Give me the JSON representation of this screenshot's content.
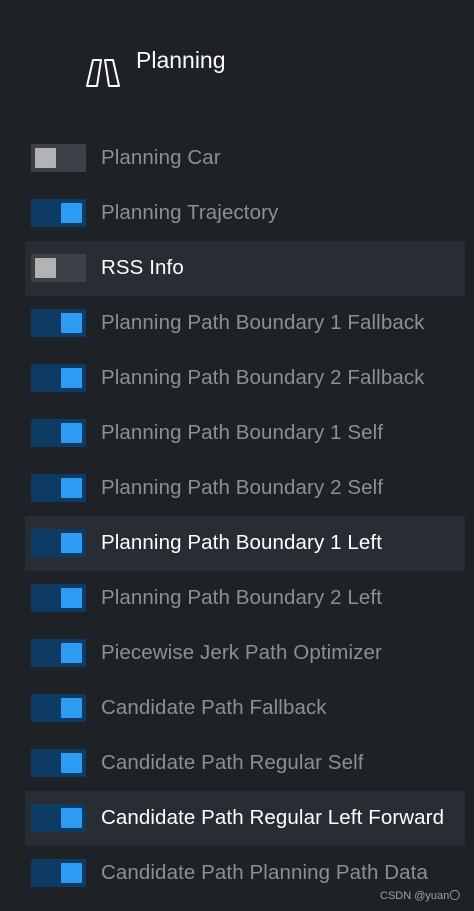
{
  "header": {
    "title": "Planning",
    "icon": "road-icon"
  },
  "items": [
    {
      "label": "Planning Car",
      "enabled": false,
      "highlighted": false
    },
    {
      "label": "Planning Trajectory",
      "enabled": true,
      "highlighted": false
    },
    {
      "label": "RSS Info",
      "enabled": false,
      "highlighted": true
    },
    {
      "label": "Planning Path Boundary 1 Fallback",
      "enabled": true,
      "highlighted": false
    },
    {
      "label": "Planning Path Boundary 2 Fallback",
      "enabled": true,
      "highlighted": false
    },
    {
      "label": "Planning Path Boundary 1 Self",
      "enabled": true,
      "highlighted": false
    },
    {
      "label": "Planning Path Boundary 2 Self",
      "enabled": true,
      "highlighted": false
    },
    {
      "label": "Planning Path Boundary 1 Left",
      "enabled": true,
      "highlighted": true
    },
    {
      "label": "Planning Path Boundary 2 Left",
      "enabled": true,
      "highlighted": false
    },
    {
      "label": "Piecewise Jerk Path Optimizer",
      "enabled": true,
      "highlighted": false
    },
    {
      "label": "Candidate Path Fallback",
      "enabled": true,
      "highlighted": false
    },
    {
      "label": "Candidate Path Regular Self",
      "enabled": true,
      "highlighted": false
    },
    {
      "label": "Candidate Path Regular Left Forward",
      "enabled": true,
      "highlighted": true
    },
    {
      "label": "Candidate Path Planning Path Data",
      "enabled": true,
      "highlighted": false
    }
  ],
  "watermark": "CSDN @yuan〇",
  "colors": {
    "background": "#1e2126",
    "highlight_row": "#282c33",
    "toggle_on_track": "#0d3b63",
    "toggle_on_knob": "#2f9cf4",
    "toggle_off_track": "#3c4047",
    "toggle_off_knob": "#b3b3b3",
    "label_normal": "#8c8f95",
    "label_highlight": "#ffffff"
  }
}
